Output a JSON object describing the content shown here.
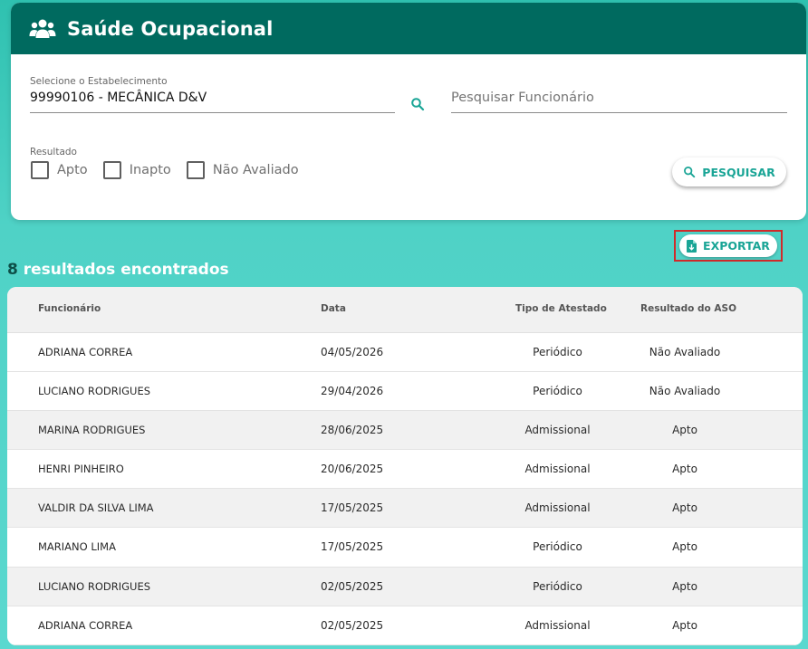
{
  "header": {
    "title": "Saúde Ocupacional",
    "icon": "users-icon"
  },
  "filters": {
    "establishment_label": "Selecione o Estabelecimento",
    "establishment_value": "99990106 - MECÂNICA D&V",
    "employee_search_placeholder": "Pesquisar Funcionário",
    "result_label": "Resultado",
    "result_options": [
      "Apto",
      "Inapto",
      "Não Avaliado"
    ],
    "search_button": "PESQUISAR"
  },
  "export_button": "EXPORTAR",
  "results": {
    "count": "8",
    "text": "resultados encontrados"
  },
  "table": {
    "columns": [
      "Funcionário",
      "Data",
      "Tipo de Atestado",
      "Resultado do ASO"
    ],
    "rows": [
      [
        "ADRIANA CORREA",
        "04/05/2026",
        "Periódico",
        "Não Avaliado"
      ],
      [
        "LUCIANO RODRIGUES",
        "29/04/2026",
        "Periódico",
        "Não Avaliado"
      ],
      [
        "MARINA RODRIGUES",
        "28/06/2025",
        "Admissional",
        "Apto"
      ],
      [
        "HENRI PINHEIRO",
        "20/06/2025",
        "Admissional",
        "Apto"
      ],
      [
        "VALDIR DA SILVA LIMA",
        "17/05/2025",
        "Admissional",
        "Apto"
      ],
      [
        "MARIANO LIMA",
        "17/05/2025",
        "Periódico",
        "Apto"
      ],
      [
        "LUCIANO RODRIGUES",
        "02/05/2025",
        "Periódico",
        "Apto"
      ],
      [
        "ADRIANA CORREA",
        "02/05/2025",
        "Admissional",
        "Apto"
      ]
    ]
  },
  "colors": {
    "header_bg": "#006a5f",
    "accent": "#1aa596",
    "page_bg": "#4fd2c6",
    "highlight_border": "#d12a2a"
  }
}
